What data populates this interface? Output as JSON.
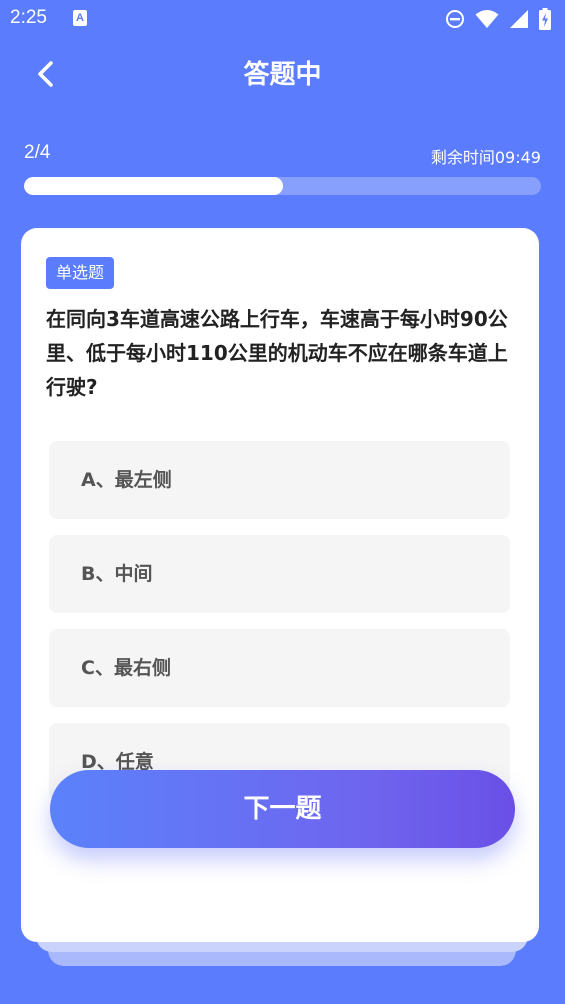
{
  "status_bar": {
    "time": "2:25",
    "notification_glyph": "A",
    "icons": [
      "notification-icon",
      "do-not-disturb-icon",
      "wifi-icon",
      "signal-icon",
      "battery-charging-icon"
    ]
  },
  "header": {
    "title": "答题中",
    "back_icon": "chevron-left-icon"
  },
  "progress": {
    "count_text": "2/4",
    "remaining_time_text": "剩余时间09:49",
    "fraction": 0.5
  },
  "question": {
    "type_label": "单选题",
    "text": "在同向3车道高速公路上行车，车速高于每小时90公里、低于每小时110公里的机动车不应在哪条车道上行驶?",
    "options": [
      {
        "label": "A、最左侧"
      },
      {
        "label": "B、中间"
      },
      {
        "label": "C、最右侧"
      },
      {
        "label": "D、任意"
      }
    ]
  },
  "next_button": {
    "label": "下一题"
  },
  "colors": {
    "background": "#5b7cfc",
    "accent": "#5b7cfc",
    "card": "#ffffff",
    "option_bg": "#f5f5f5",
    "button_gradient_start": "#5b82fb",
    "button_gradient_end": "#6a4fe6"
  }
}
